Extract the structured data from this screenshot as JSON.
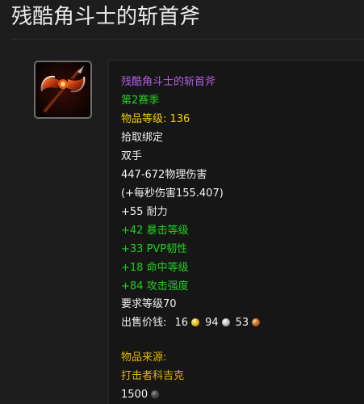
{
  "page": {
    "title": "残酷角斗士的斩首斧"
  },
  "item": {
    "icon": "axe-icon",
    "name": "残酷角斗士的斩首斧",
    "season": "第2赛季",
    "item_level_label": "物品等级: ",
    "item_level_value": "136",
    "binding": "拾取绑定",
    "slot": "双手",
    "damage": "447-672物理伤害",
    "dps": "(+每秒伤害155.407)",
    "stamina": "+55 耐力",
    "stats_green": [
      "+42 暴击等级",
      "+33 PVP韧性",
      "+18 命中等级",
      "+84 攻击强度"
    ],
    "requires_level": "要求等级70",
    "sell_price_label": "出售价钱: ",
    "sell_gold": "16",
    "sell_silver": "94",
    "sell_copper": "53",
    "source_label": "物品来源:",
    "source": "打击者科吉克",
    "honor_cost": "1500"
  },
  "colors": {
    "background": "#1d1d1d",
    "tooltip_bg": "#161616",
    "epic": "#b35ee0",
    "green": "#1fd11f",
    "gold": "#f0d000",
    "text": "#f1f1f1"
  }
}
